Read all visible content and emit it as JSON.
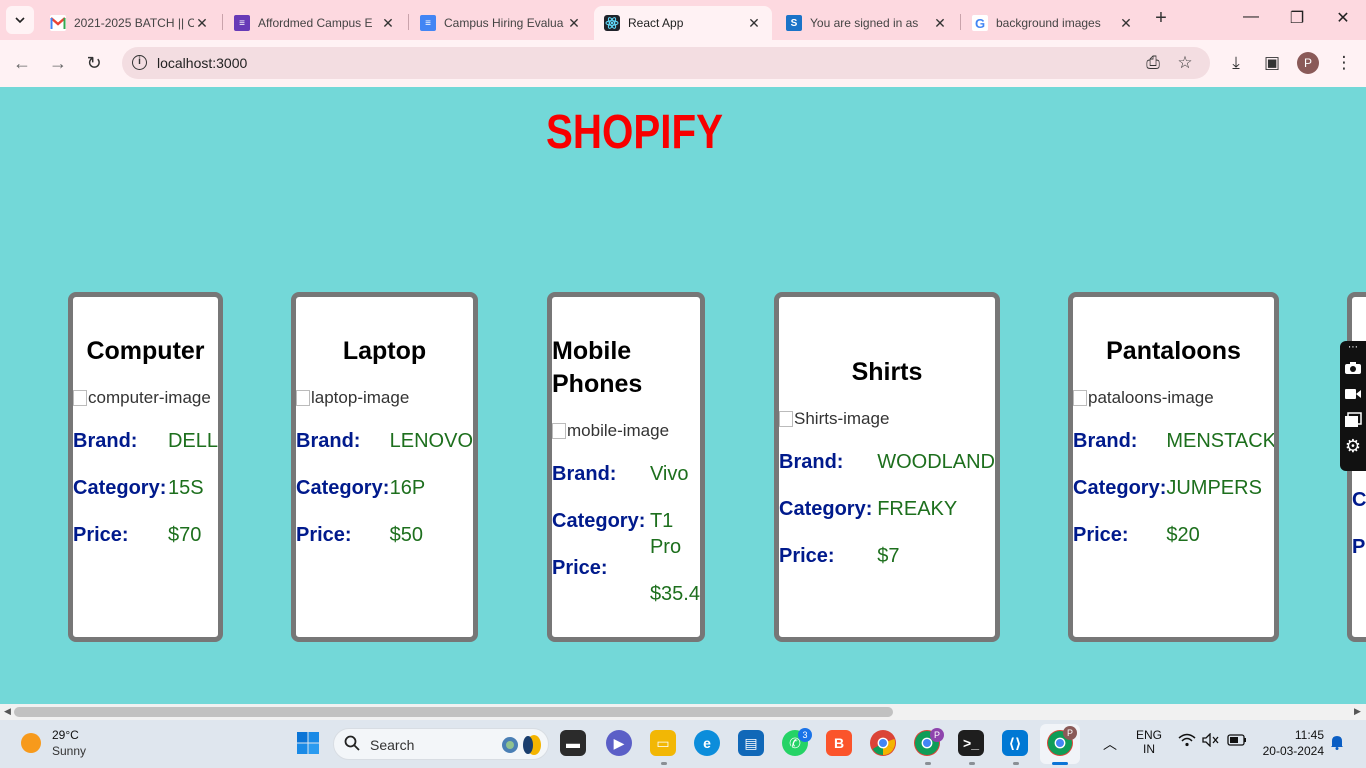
{
  "browser": {
    "tabs": [
      {
        "title": "2021-2025 BATCH || C",
        "icon": "gmail-icon",
        "active": false
      },
      {
        "title": "Affordmed Campus E",
        "icon": "forms-icon",
        "active": false
      },
      {
        "title": "Campus Hiring Evalua",
        "icon": "docs-icon",
        "active": false
      },
      {
        "title": "React App",
        "icon": "react-icon",
        "active": true
      },
      {
        "title": "You are signed in as",
        "icon": "s-icon",
        "active": false
      },
      {
        "title": "background images",
        "icon": "google-icon",
        "active": false
      }
    ],
    "url": "localhost:3000",
    "profile_initial": "P"
  },
  "page": {
    "brand": "SHOPIFY",
    "labels": {
      "brand": "Brand:",
      "category": "Category:",
      "price": "Price:"
    },
    "products": [
      {
        "name": "Computer",
        "image_alt": "computer-image",
        "brand": "DELL",
        "category": "15S",
        "price": "$70"
      },
      {
        "name": "Laptop",
        "image_alt": "laptop-image",
        "brand": "LENOVO",
        "category": "16P",
        "price": "$50"
      },
      {
        "name": "Mobile Phones",
        "image_alt": "mobile-image",
        "brand": "Vivo",
        "category": "T1 Pro",
        "price": "$35.4"
      },
      {
        "name": "Shirts",
        "image_alt": "Shirts-image",
        "brand": "WOODLAND",
        "category": "FREAKY",
        "price": "$7"
      },
      {
        "name": "Pantaloons",
        "image_alt": "pataloons-image",
        "brand": "MENSTACK",
        "category": "JUMPERS",
        "price": "$20"
      }
    ],
    "partial_card_labels": [
      "Ca",
      "Pr"
    ]
  },
  "taskbar": {
    "weather": {
      "temp": "29°C",
      "condition": "Sunny"
    },
    "search_placeholder": "Search",
    "whatsapp_badge": "3",
    "profile_badge": "P",
    "language": {
      "line1": "ENG",
      "line2": "IN"
    },
    "time": "11:45",
    "date": "20-03-2024"
  },
  "colors": {
    "page_bg": "#73d8d8",
    "brand_title": "#f80000",
    "label_text": "#001a8c",
    "value_text": "#1d6f1d",
    "card_border": "#777777",
    "tabstrip_bg": "#fdd9e0"
  }
}
